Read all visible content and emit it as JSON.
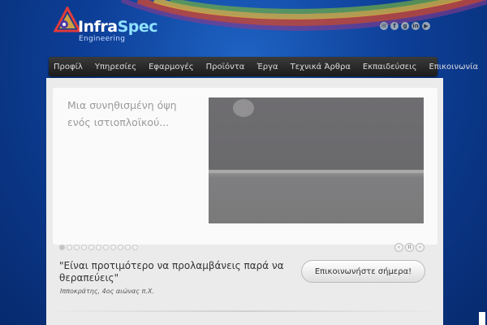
{
  "header": {
    "logo": {
      "name_part1": "Infra",
      "name_part2": "Spec",
      "tagline": "Engineering"
    },
    "social_icons": [
      "mail-icon",
      "facebook-icon",
      "google-plus-icon",
      "linkedin-icon",
      "youtube-icon"
    ],
    "social_glyphs": [
      "✉",
      "f",
      "g",
      "in",
      "▶"
    ]
  },
  "nav": {
    "items": [
      "Προφίλ",
      "Υπηρεσίες",
      "Εφαρμογές",
      "Προϊόντα",
      "Έργα",
      "Τεχνικά Άρθρα",
      "Εκπαιδεύσεις",
      "Επικοινωνία"
    ]
  },
  "slider": {
    "text": "Μια συνηθισμένη όψη ενός ιστιοπλοϊκού...",
    "page_count": 11,
    "active_index": 0,
    "controls": {
      "prev": "‹",
      "pause": "II",
      "next": "›"
    }
  },
  "quote": {
    "text": "\"Είναι προτιμότερο να προλαμβάνεις παρά να θεραπεύεις\"",
    "attribution": "Ιπποκράτης, 4ος αιώνας π.Χ."
  },
  "cta": {
    "label": "Επικοινωνήστε σήμερα!"
  },
  "colors": {
    "background": "#0d3f98",
    "navbar": "#1b1b1b",
    "content": "#ebebeb"
  }
}
